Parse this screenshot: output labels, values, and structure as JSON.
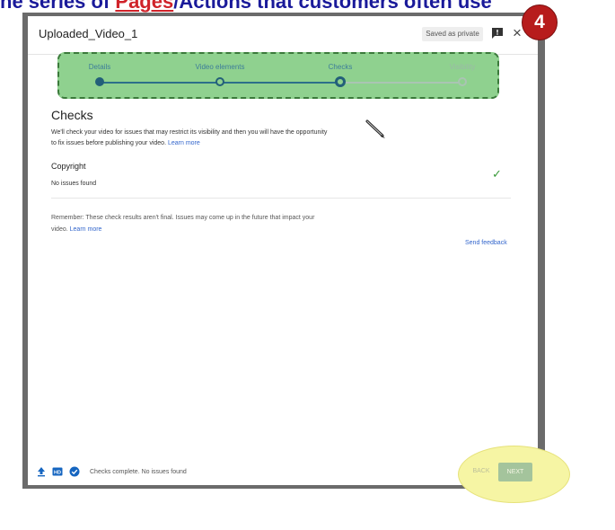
{
  "banner": {
    "text_before": "ne series of ",
    "text_highlight": "Pages",
    "text_after": "/Actions that customers often use"
  },
  "dialog": {
    "title": "Uploaded_Video_1",
    "saved_badge": "Saved as private",
    "close_glyph": "×"
  },
  "callout_number": "4",
  "stepper": {
    "steps": [
      {
        "label": "Details",
        "state": "done"
      },
      {
        "label": "Video elements",
        "state": "done"
      },
      {
        "label": "Checks",
        "state": "current"
      },
      {
        "label": "Visibility",
        "state": "upcoming"
      }
    ],
    "highlight_color": "#8fd18f"
  },
  "checks": {
    "heading": "Checks",
    "description": "We'll check your video for issues that may restrict its visibility and then you will have the opportunity to fix issues before publishing your video.",
    "learn_more": "Learn more",
    "copyright_title": "Copyright",
    "copyright_status": "No issues found",
    "remember_text": "Remember: These check results aren't final. Issues may come up in the future that impact your video.",
    "remember_link": "Learn more",
    "send_feedback": "Send feedback"
  },
  "footer": {
    "status": "Checks complete. No issues found",
    "back_label": "BACK",
    "next_label": "NEXT",
    "icons": [
      "upload-icon",
      "hd-icon",
      "check-circle-icon"
    ]
  },
  "colors": {
    "accent_blue": "#3366cc",
    "check_green": "#3a9a3a",
    "badge_red": "#b71c1c",
    "highlight_yellow": "#f6f5a4"
  }
}
